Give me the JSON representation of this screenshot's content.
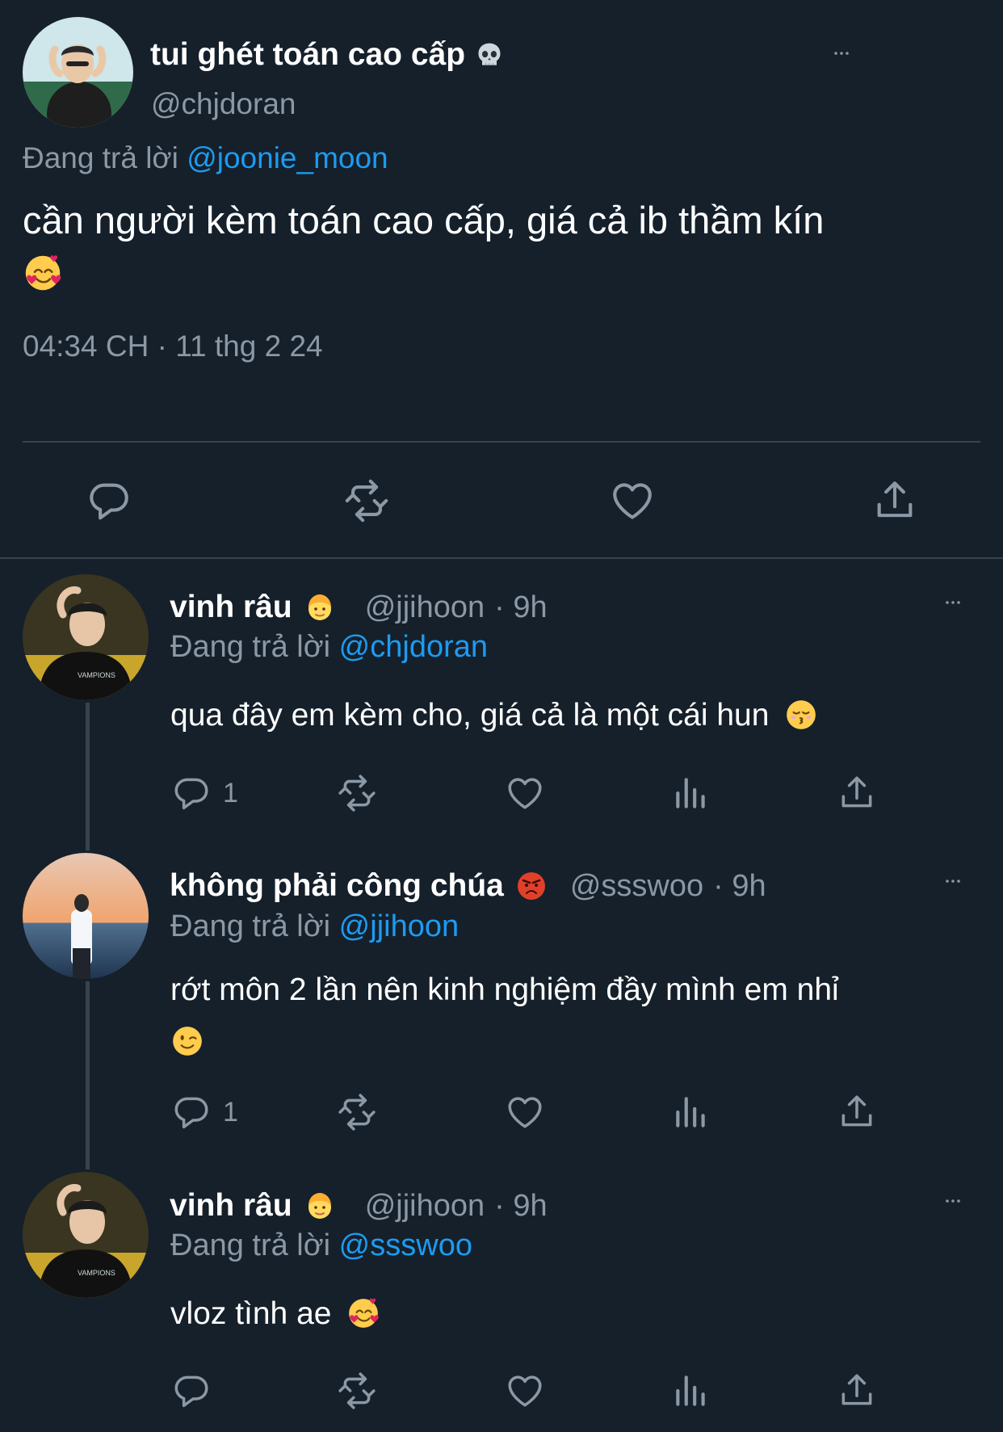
{
  "main_tweet": {
    "display_name": "tui ghét toán cao cấp",
    "name_emoji": "skull-emoji",
    "handle": "@chjdoran",
    "reply_prefix": "Đang trả lời",
    "reply_to": "@joonie_moon",
    "text": "cần người kèm toán cao cấp, giá cả ib thầm kín",
    "text_emoji": "smiling-face-with-hearts-emoji",
    "timestamp": "04:34 CH · 11 thg 2 24",
    "actions": [
      "reply-icon",
      "retweet-icon",
      "like-icon",
      "share-icon"
    ]
  },
  "replies": [
    {
      "display_name": "vinh râu",
      "name_emoji": "blond-person-emoji",
      "handle": "@jjihoon",
      "time": "· 9h",
      "reply_prefix": "Đang trả lời",
      "reply_to": "@chjdoran",
      "text": "qua đây em kèm cho, giá cả là một cái hun",
      "text_emoji": "kissing-face-emoji",
      "reply_count": "1"
    },
    {
      "display_name": "không phải công chúa",
      "name_emoji": "angry-face-emoji",
      "handle": "@ssswoo",
      "time": "· 9h",
      "reply_prefix": "Đang trả lời",
      "reply_to": "@jjihoon",
      "text": "rớt môn 2 lần nên kinh nghiệm đầy mình em nhỉ",
      "text_emoji": "winking-face-emoji",
      "reply_count": "1"
    },
    {
      "display_name": "vinh râu",
      "name_emoji": "blond-person-emoji",
      "handle": "@jjihoon",
      "time": "· 9h",
      "reply_prefix": "Đang trả lời",
      "reply_to": "@ssswoo",
      "text": "vloz tình ae",
      "text_emoji": "smiling-face-with-hearts-emoji",
      "reply_count": ""
    }
  ],
  "colors": {
    "background": "#15202b",
    "text": "#ffffff",
    "muted": "#8b98a5",
    "link": "#1d9bf0",
    "divider": "#38444d"
  }
}
